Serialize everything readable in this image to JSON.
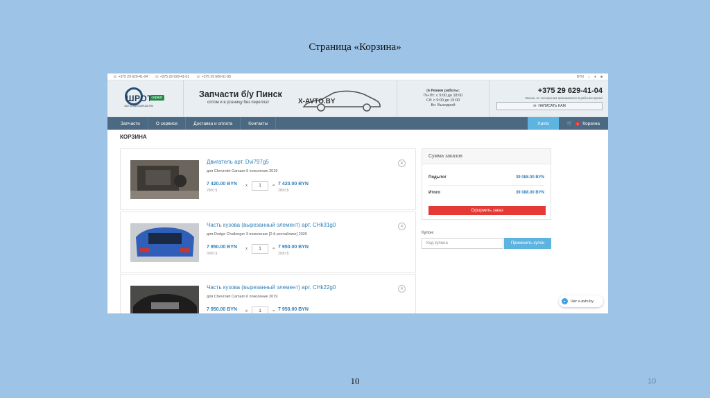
{
  "slide": {
    "title": "Страница «Корзина»",
    "page_center": "10",
    "page_right": "10"
  },
  "topbar": {
    "phones": [
      "+375 29 629-41-04",
      "+375 29 629-41-01",
      "+375 29 606-61-95"
    ],
    "lang": "BYN"
  },
  "header": {
    "logo_word": "ШРОТ",
    "logo_badge": "сервис",
    "logo_sub": "ВСЕ О АВТОЗАПЧАСТЯХ",
    "banner_title": "Запчасти б/у Пинск",
    "banner_sub": "оптом и в розницу без переплат",
    "banner_brand": "X-AVTO.BY",
    "hours_title": "Режим работы:",
    "hours_lines": [
      "Пн-Пт: с 9:00 до 18:00",
      "Сб: с 9:00 до 15:00",
      "Вс: Выходной"
    ],
    "phone": "+375 29 629-41-04",
    "phone_note": "Заказы по телефонам принимаются в рабочее время",
    "write_btn": "НАПИСАТЬ НАМ"
  },
  "nav": {
    "items": [
      "Запчасти",
      "О сервисе",
      "Доставка и оплата",
      "Контакты"
    ],
    "xavto": "Xavto",
    "cart_label": "Корзина",
    "cart_count": "3"
  },
  "page_heading": "КОРЗИНА",
  "cart_items": [
    {
      "name": "Двигатель арт. Dvi797g5",
      "for": "для Chevrolet Camaro 6 поколение 2019",
      "price": "7 420.00 BYN",
      "usd": "2800 $",
      "qty": "1",
      "total": "7 420.00 BYN",
      "total_usd": "2800 $"
    },
    {
      "name": "Часть кузова (вырезанный элемент) арт. CHk31g0",
      "for": "для Dodge Challenger 3 поколение [2-й рестайлинг] 2020",
      "price": "7 950.00 BYN",
      "usd": "3000 $",
      "qty": "1",
      "total": "7 950.00 BYN",
      "total_usd": "3000 $"
    },
    {
      "name": "Часть кузова (вырезанный элемент) арт. CHk22g0",
      "for": "для Chevrolet Camaro 6 поколение 2019",
      "price": "7 950.00 BYN",
      "usd": "",
      "qty": "1",
      "total": "7 950.00 BYN",
      "total_usd": ""
    }
  ],
  "summary": {
    "title": "Сумма заказов",
    "subtotal_label": "Подытог",
    "subtotal": "39 088.00 BYN",
    "total_label": "Итого",
    "total": "39 088.00 BYN",
    "order_btn": "Оформить заказ"
  },
  "coupon": {
    "label": "Купон:",
    "placeholder": "Код купона",
    "apply_btn": "Применить купон"
  },
  "chat": {
    "label": "Чат x-avto.by"
  },
  "colors": {
    "background": "#9dc3e6",
    "nav": "#4b6982",
    "accent": "#5eb4e0",
    "link": "#2e7fb8",
    "order": "#e53935"
  }
}
